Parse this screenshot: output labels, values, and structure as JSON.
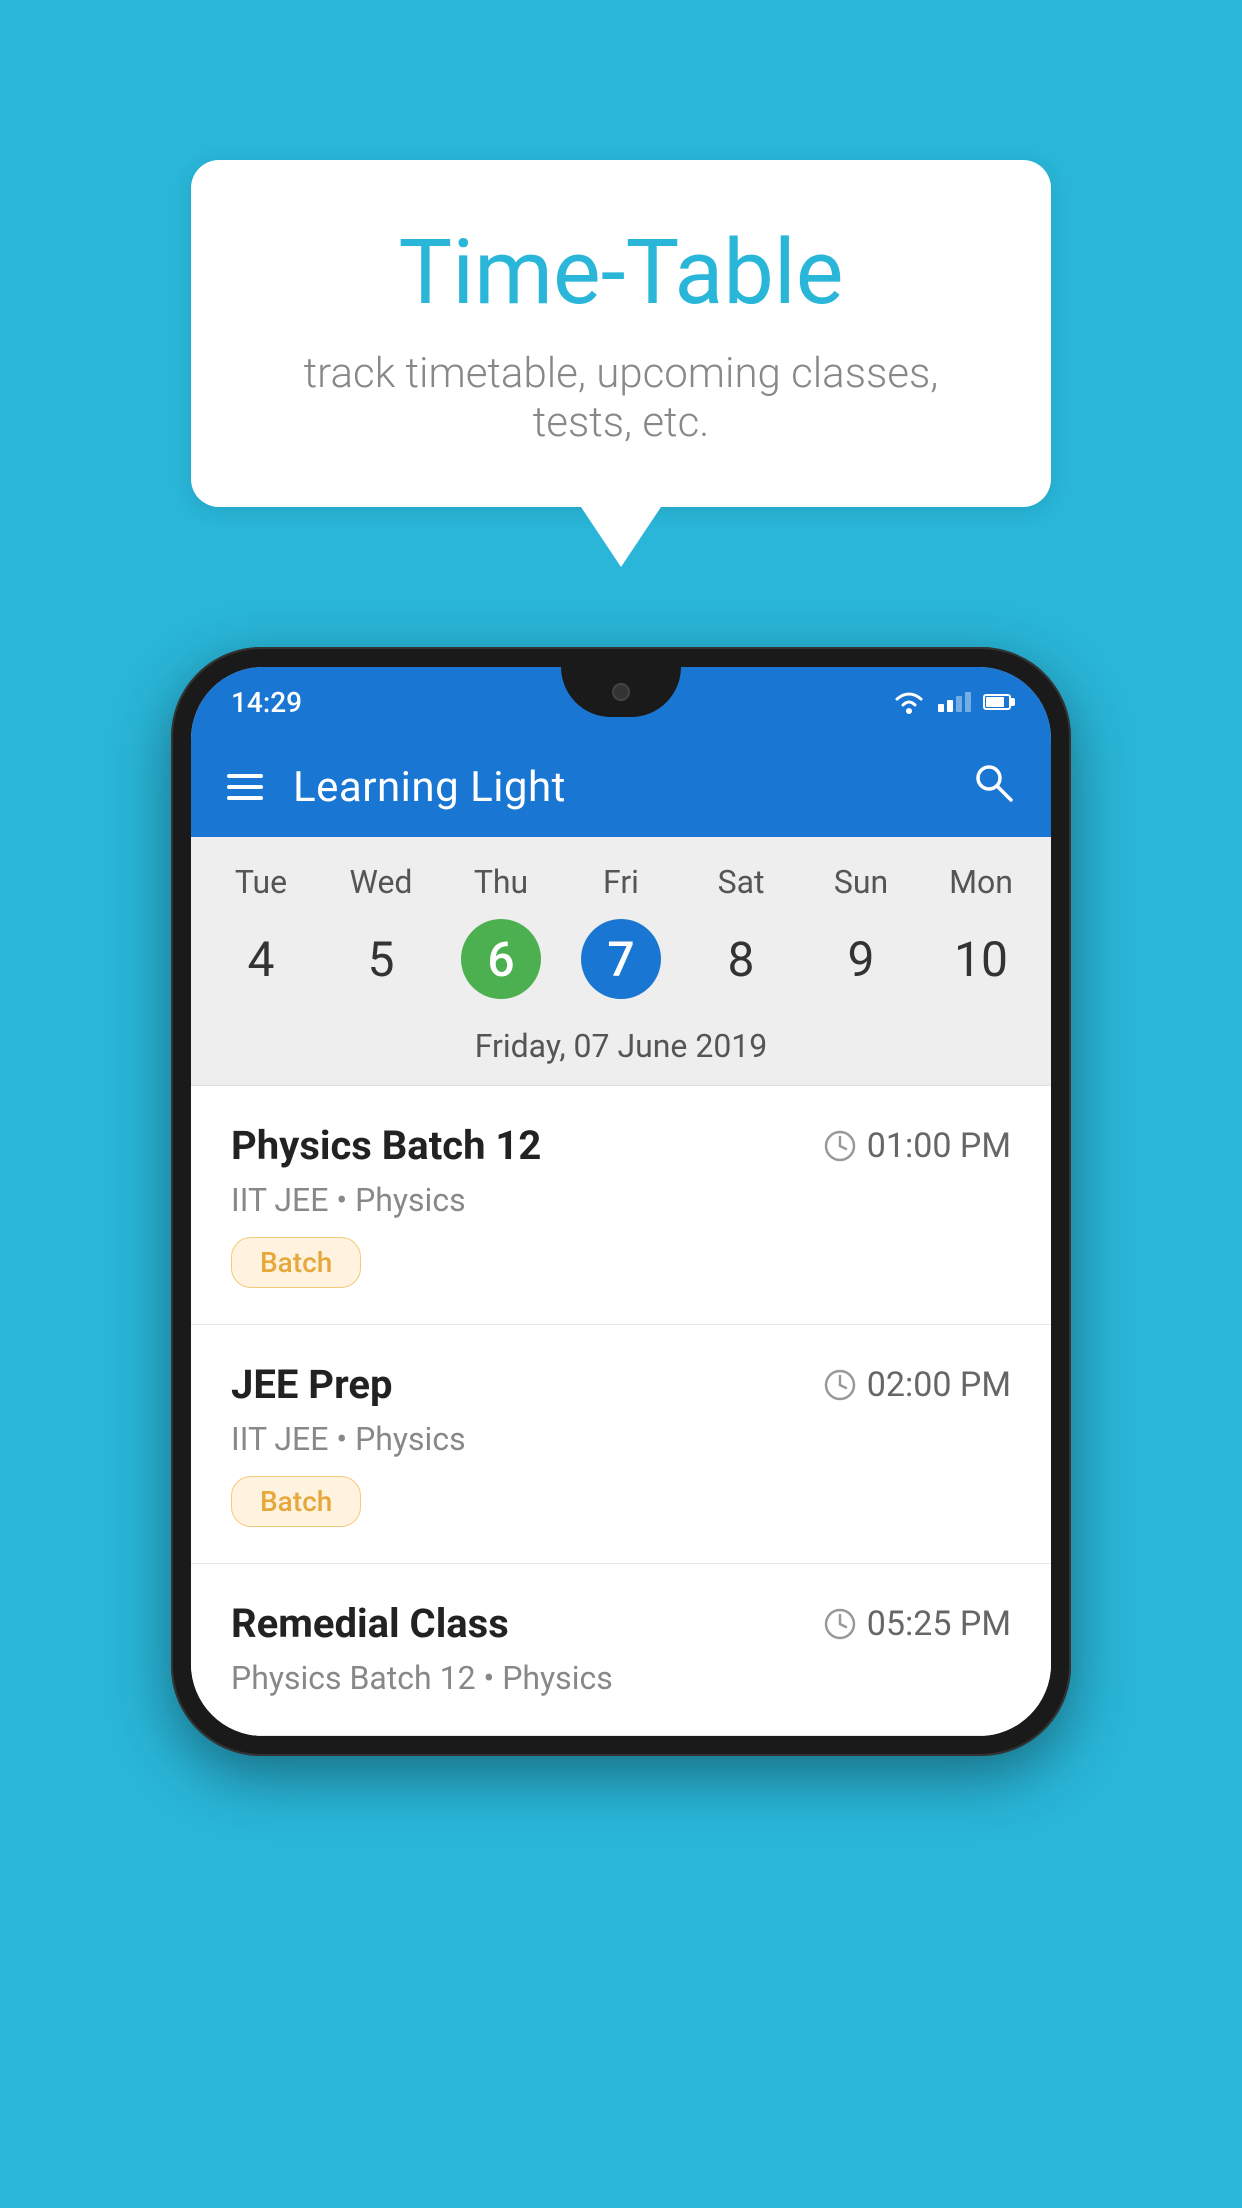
{
  "background_color": "#29B6D8",
  "speech_bubble": {
    "title": "Time-Table",
    "subtitle": "track timetable, upcoming classes, tests, etc."
  },
  "phone": {
    "status_bar": {
      "time": "14:29"
    },
    "app_bar": {
      "title": "Learning Light"
    },
    "calendar": {
      "days": [
        "Tue",
        "Wed",
        "Thu",
        "Fri",
        "Sat",
        "Sun",
        "Mon"
      ],
      "dates": [
        "4",
        "5",
        "6",
        "7",
        "8",
        "9",
        "10"
      ],
      "today_index": 2,
      "selected_index": 3,
      "selected_label": "Friday, 07 June 2019"
    },
    "schedule_items": [
      {
        "title": "Physics Batch 12",
        "time": "01:00 PM",
        "subtitle": "IIT JEE • Physics",
        "badge": "Batch"
      },
      {
        "title": "JEE Prep",
        "time": "02:00 PM",
        "subtitle": "IIT JEE • Physics",
        "badge": "Batch"
      },
      {
        "title": "Remedial Class",
        "time": "05:25 PM",
        "subtitle": "Physics Batch 12 • Physics",
        "badge": null
      }
    ]
  }
}
